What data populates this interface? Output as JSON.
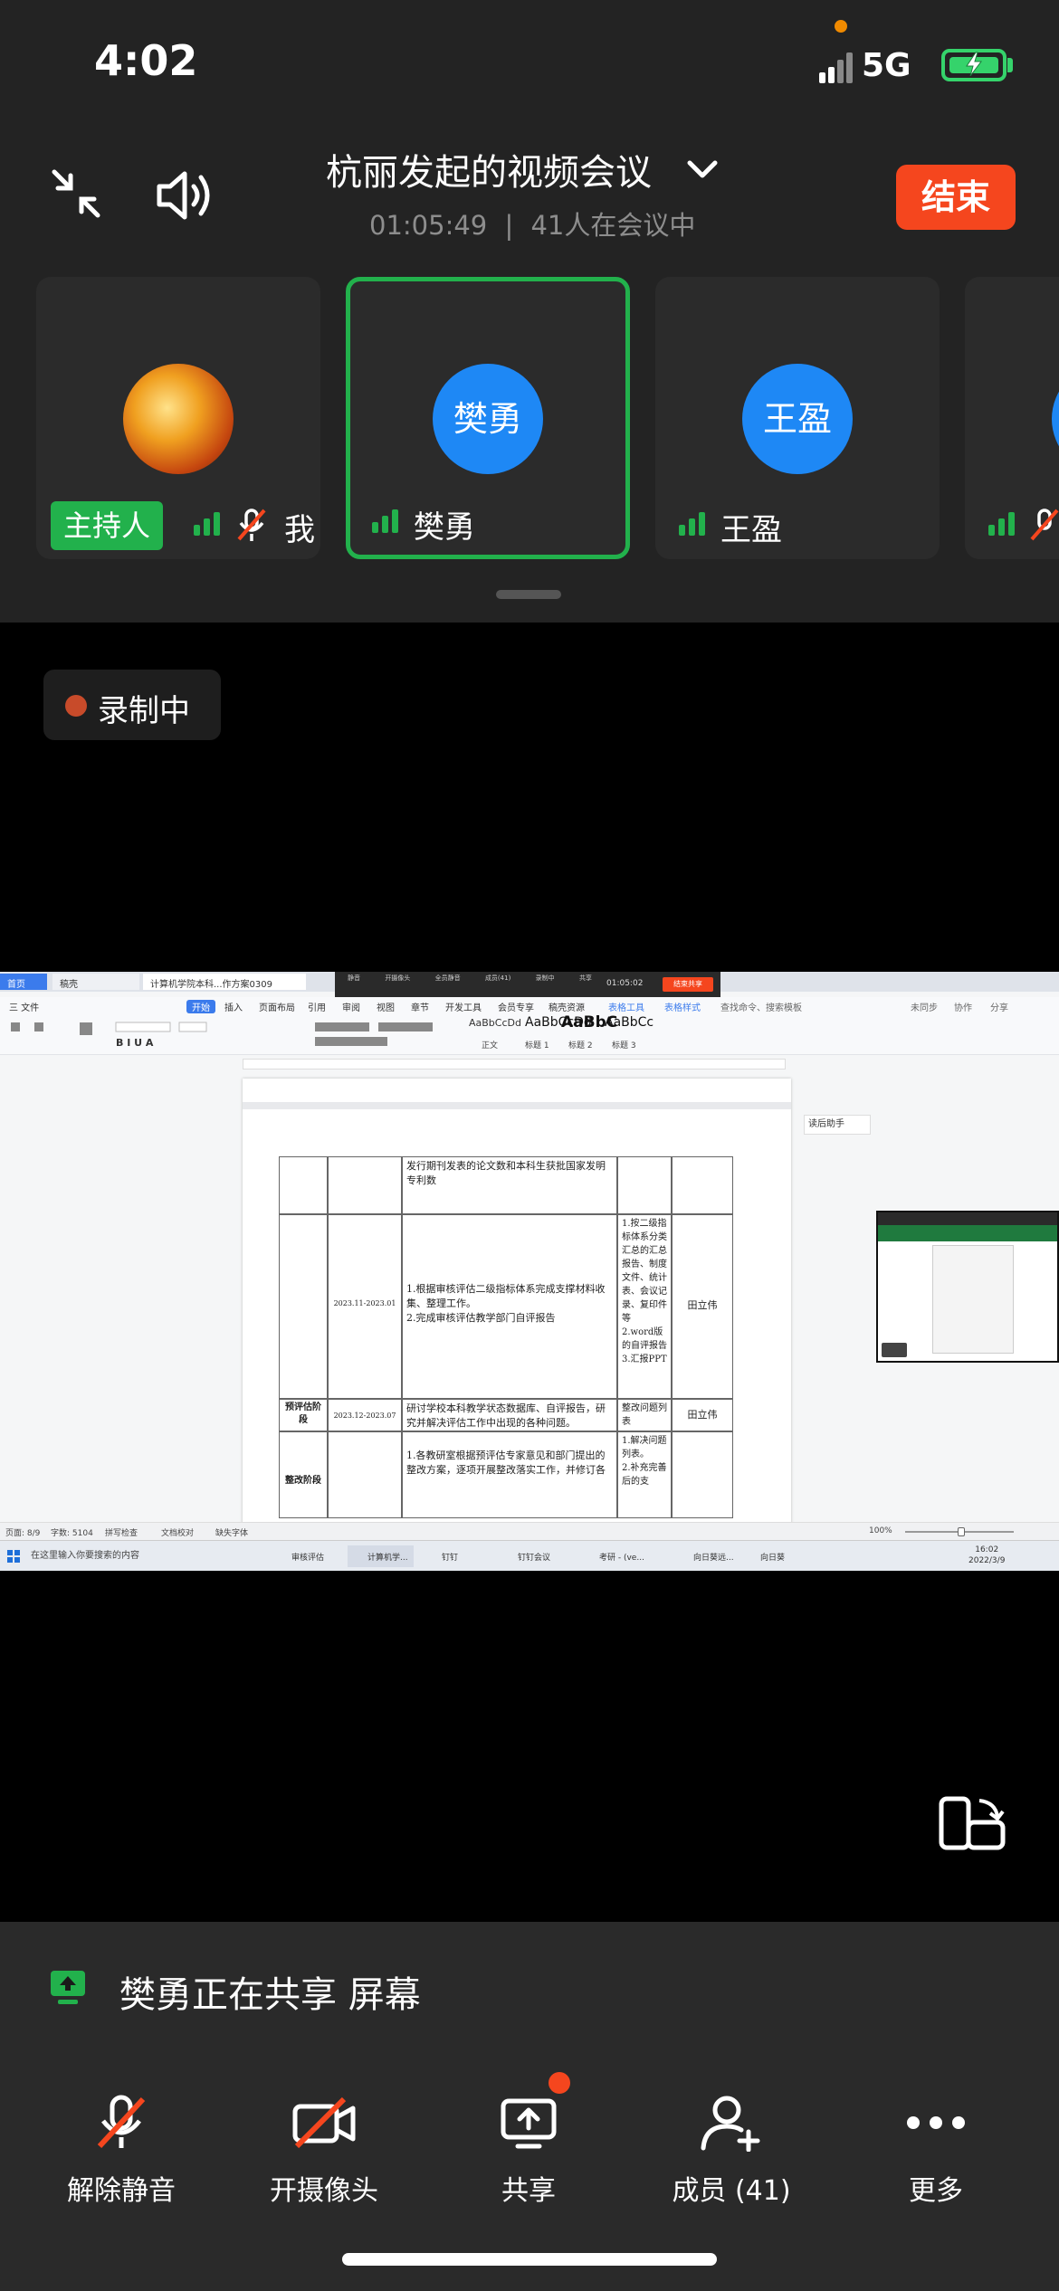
{
  "status_bar": {
    "time": "4:02",
    "network": "5G"
  },
  "header": {
    "title": "杭丽发起的视频会议",
    "duration": "01:05:49",
    "separator": "|",
    "participants_text": "41人在会议中",
    "end_label": "结束"
  },
  "tiles": [
    {
      "name": "我",
      "badge": "主持人",
      "muted": true,
      "avatar_type": "image"
    },
    {
      "name": "樊勇",
      "avatar_text": "樊勇",
      "active": true
    },
    {
      "name": "王盈",
      "avatar_text": "王盈"
    }
  ],
  "recording": {
    "label": "录制中"
  },
  "shared_screen": {
    "tabs": [
      "首页",
      "稿壳",
      "计算机学院本科...作方案0309"
    ],
    "menu": [
      "三 文件",
      "开始",
      "插入",
      "页面布局",
      "引用",
      "审阅",
      "视图",
      "章节",
      "开发工具",
      "会员专享",
      "稿壳资源",
      "表格工具",
      "表格样式"
    ],
    "menu_active": "开始",
    "search_hint": "查找命令、搜索模板",
    "right_tools": [
      "未同步",
      "协作",
      "分享"
    ],
    "styles": [
      "AaBbCcDd",
      "AaBbCcDd",
      "AaBbC",
      "AaBbCc"
    ],
    "style_names": [
      "正文",
      "标题 1",
      "标题 2",
      "标题 3"
    ],
    "toolbar_time": "01:05:02",
    "toolbar_end": "结束共享",
    "toolbar_items": [
      "静音",
      "开摄像头",
      "全员静音",
      "成员(41)",
      "录制中",
      "共享"
    ],
    "side_panel": "读后助手",
    "table": {
      "row0_col3": "发行期刊发表的论文数和本科生获批国家发明专利数",
      "row1_date": "2023.11-2023.01",
      "row1_task": "1.根据审核评估二级指标体系完成支撑材料收集、整理工作。\n2.完成审核评估教学部门自评报告",
      "row1_output": "1.按二级指标体系分类汇总的汇总报告、制度文件、统计表、会议记录、复印件等\n2.word版的自评报告\n3.汇报PPT",
      "row1_owner": "田立伟",
      "row2_stage": "预评估阶段",
      "row2_date": "2023.12-2023.07",
      "row2_task": "研讨学校本科教学状态数据库、自评报告，研究并解决评估工作中出现的各种问题。",
      "row2_output": "整改问题列表",
      "row2_owner": "田立伟",
      "row3_stage": "整改阶段",
      "row3_task": "1.各教研室根据预评估专家意见和部门提出的整改方案，逐项开展整改落实工作，并修订各",
      "row3_output": "1.解决问题列表。\n2.补充完善后的支"
    },
    "status": [
      "页面: 8/9",
      "字数: 5104",
      "拼写检查",
      "文档校对",
      "缺失字体"
    ],
    "zoom": "100%",
    "taskbar_search": "在这里输入你要搜索的内容",
    "taskbar_items": [
      "审核评估",
      "计算机学...",
      "钉钉",
      "钉钉会议",
      "考研 - (ve...",
      "向日葵远...",
      "向日葵"
    ],
    "clock_time": "16:02",
    "clock_date": "2022/3/9"
  },
  "share_status": "樊勇正在共享 屏幕",
  "controls": [
    {
      "label": "解除静音",
      "icon": "mic-muted-icon"
    },
    {
      "label": "开摄像头",
      "icon": "camera-off-icon"
    },
    {
      "label": "共享",
      "icon": "share-screen-icon",
      "dot": true
    },
    {
      "label": "成员 (41)",
      "icon": "add-member-icon"
    },
    {
      "label": "更多",
      "icon": "more-icon"
    }
  ],
  "colors": {
    "accent_green": "#22b14c",
    "end_red": "#f5461e",
    "avatar_blue": "#1e88f5"
  }
}
